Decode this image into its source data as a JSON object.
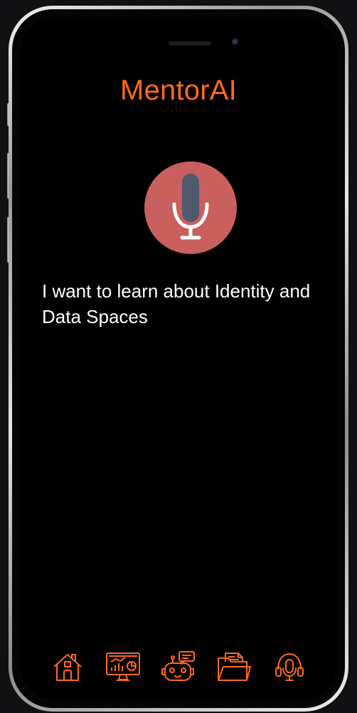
{
  "app": {
    "title": "MentorAI"
  },
  "voice": {
    "mic_icon": "microphone-icon",
    "transcript": "I want to learn about Identity and Data Spaces"
  },
  "nav": {
    "items": [
      {
        "id": "home",
        "icon": "home-icon"
      },
      {
        "id": "dashboard",
        "icon": "monitor-chart-icon"
      },
      {
        "id": "chatbot",
        "icon": "robot-chat-icon"
      },
      {
        "id": "documents",
        "icon": "folder-documents-icon"
      },
      {
        "id": "voice-assistant",
        "icon": "headset-mic-icon"
      }
    ]
  },
  "colors": {
    "accent": "#ff6a1a",
    "mic_circle": "#c9605e",
    "mic_body": "#4f5a6e",
    "screen_bg": "#000000",
    "text": "#ffffff"
  }
}
